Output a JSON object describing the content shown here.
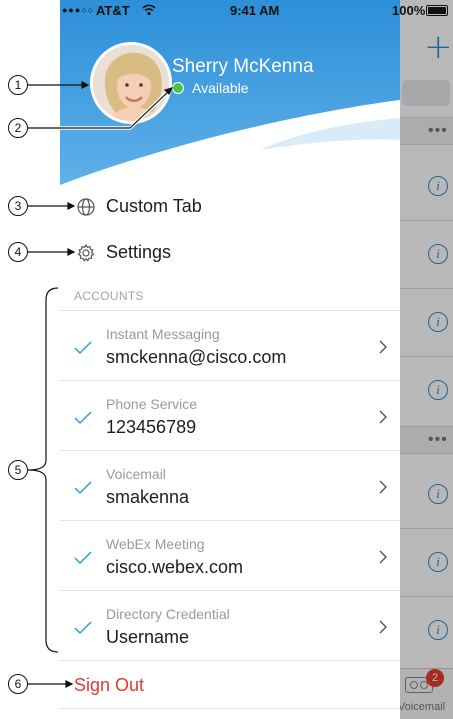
{
  "status_bar": {
    "signal": "●●●○○",
    "carrier": "AT&T",
    "time": "9:41 AM",
    "battery": "100%"
  },
  "profile": {
    "name": "Sherry McKenna",
    "presence": "Available",
    "presence_color": "#4cc24a"
  },
  "menu": {
    "custom_tab": "Custom Tab",
    "settings": "Settings"
  },
  "accounts": {
    "header": "ACCOUNTS",
    "items": [
      {
        "title": "Instant Messaging",
        "value": "smckenna@cisco.com"
      },
      {
        "title": "Phone Service",
        "value": "123456789"
      },
      {
        "title": "Voicemail",
        "value": "smakenna"
      },
      {
        "title": "WebEx Meeting",
        "value": "cisco.webex.com"
      },
      {
        "title": "Directory Credential",
        "value": "Username"
      }
    ]
  },
  "sign_out": "Sign Out",
  "background_app": {
    "plus": "+",
    "dots": "•••",
    "info": "i",
    "voicemail_badge": "2",
    "voicemail_label": "Voicemail"
  },
  "callouts": [
    "1",
    "2",
    "3",
    "4",
    "5",
    "6"
  ],
  "colors": {
    "accent": "#2a8fd6",
    "header_gradient_top": "#2c8fd8",
    "header_gradient_bottom": "#5fb1e8",
    "sign_out": "#e8382c",
    "check": "#2a9de0"
  }
}
